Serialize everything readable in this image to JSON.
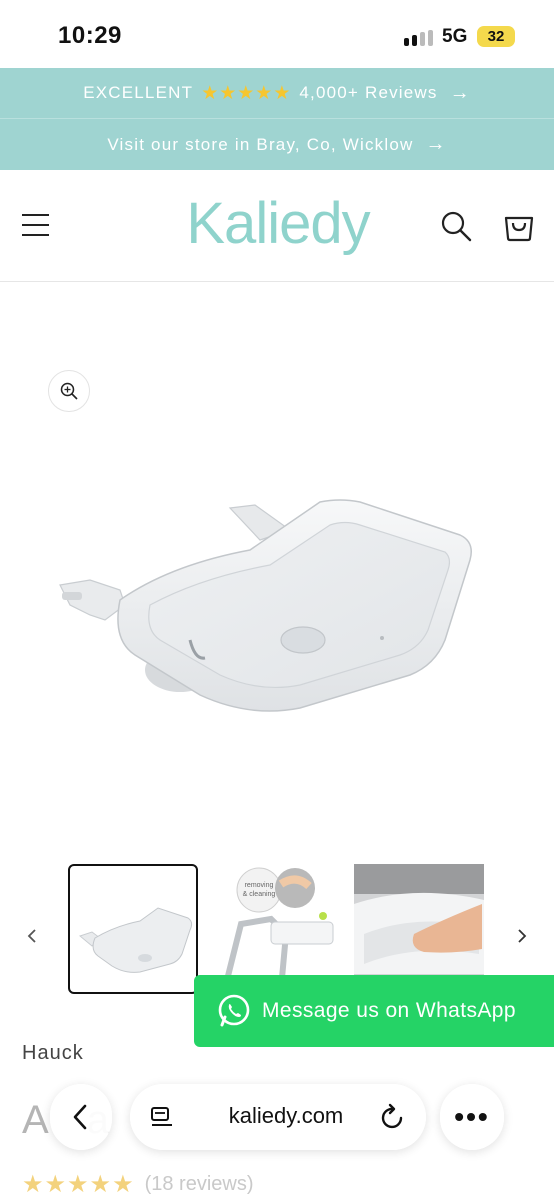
{
  "status_bar": {
    "time": "10:29",
    "network": "5G",
    "battery": "32",
    "battery_color": "#f4d94c"
  },
  "announcements": {
    "reviews": {
      "prefix": "EXCELLENT",
      "stars": "★★★★★",
      "suffix": "4,000+ Reviews",
      "arrow": "→"
    },
    "store": {
      "text": "Visit our store in Bray, Co, Wicklow",
      "arrow": "→"
    },
    "bg_color": "#9fd4d1"
  },
  "header": {
    "logo": "Kaliedy",
    "logo_color": "#8fd3cc",
    "menu_icon": "hamburger-icon",
    "search_icon": "search-icon",
    "cart_icon": "bag-icon"
  },
  "gallery": {
    "zoom_icon": "zoom-in-icon",
    "main_image": "high-chair-tray-image",
    "thumbnails": [
      {
        "image": "tray-thumbnail",
        "selected": true
      },
      {
        "image": "removing-cleaning-thumbnail",
        "badge": "removing & cleaning"
      },
      {
        "image": "hand-on-tray-thumbnail"
      }
    ],
    "prev_icon": "chevron-left-icon",
    "next_icon": "chevron-right-icon"
  },
  "whatsapp": {
    "label": "Message us on WhatsApp",
    "color": "#25d366",
    "icon": "whatsapp-icon"
  },
  "product": {
    "brand": "Hauck",
    "title_visible_start": "A",
    "title_visible_end": "a",
    "rating": 4.5,
    "rating_stars": "★★★★★",
    "reviews_text": "(18 reviews)"
  },
  "browser": {
    "url": "kaliedy.com",
    "back_icon": "back-arrow-icon",
    "reader_icon": "reader-icon",
    "reload_icon": "reload-icon",
    "more_label": "•••"
  }
}
